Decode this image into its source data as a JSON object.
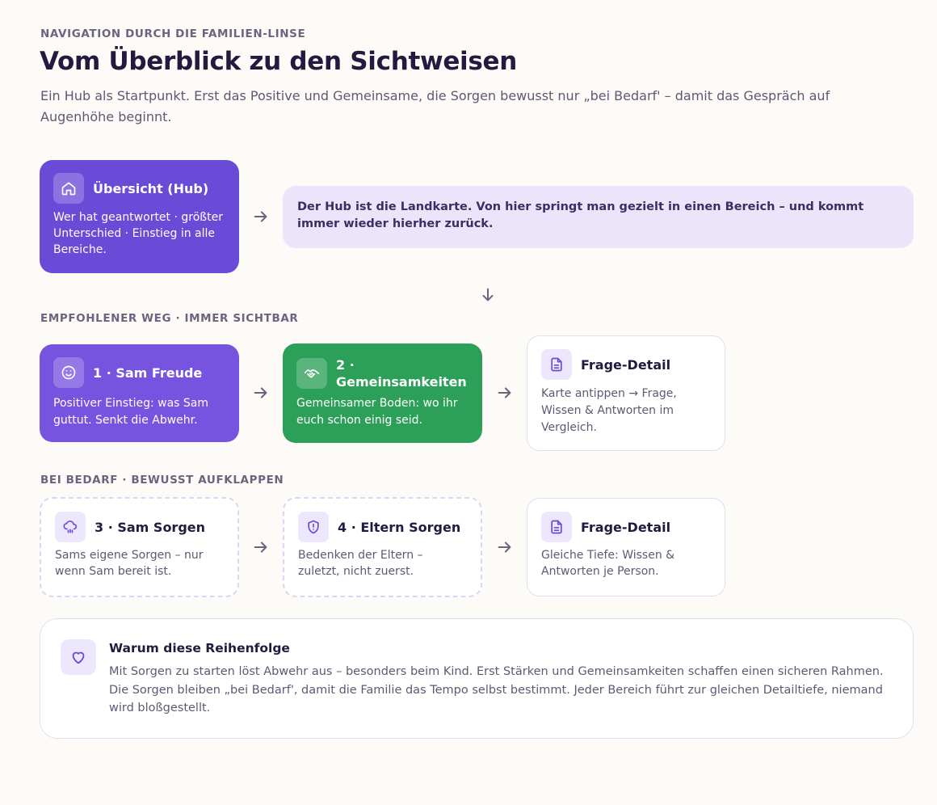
{
  "header": {
    "eyebrow": "NAVIGATION DURCH DIE FAMILIEN-LINSE",
    "title": "Vom Überblick zu den Sichtweisen",
    "subtitle": "Ein Hub als Startpunkt. Erst das Positive und Gemeinsame, die Sorgen bewusst nur „bei Bedarf' – damit das Gespräch auf Augenhöhe beginnt."
  },
  "hub": {
    "icon": "home-icon",
    "title": "Übersicht (Hub)",
    "desc": "Wer hat geantwortet · größter Unterschied · Einstieg in alle Bereiche.",
    "note": "Der Hub ist die Landkarte. Von hier springt man gezielt in einen Bereich – und kommt immer wieder hierher zurück."
  },
  "recommended": {
    "label": "EMPFOHLENER WEG · IMMER SICHTBAR",
    "steps": [
      {
        "icon": "smile-icon",
        "title": "1 · Sam Freude",
        "desc": "Positiver Einstieg: was Sam guttut. Senkt die Abwehr."
      },
      {
        "icon": "handshake-icon",
        "title": "2 · Gemeinsamkeiten",
        "desc": "Gemeinsamer Boden: wo ihr euch schon einig seid."
      },
      {
        "icon": "document-icon",
        "title": "Frage-Detail",
        "desc": "Karte antippen → Frage, Wissen & Antworten im Vergleich."
      }
    ]
  },
  "on_demand": {
    "label": "BEI BEDARF · BEWUSST AUFKLAPPEN",
    "steps": [
      {
        "icon": "rain-cloud-icon",
        "title": "3 · Sam Sorgen",
        "desc": "Sams eigene Sorgen – nur wenn Sam bereit ist."
      },
      {
        "icon": "shield-alert-icon",
        "title": "4 · Eltern Sorgen",
        "desc": "Bedenken der Eltern – zuletzt, nicht zuerst."
      },
      {
        "icon": "document-icon",
        "title": "Frage-Detail",
        "desc": "Gleiche Tiefe: Wissen & Antworten je Person."
      }
    ]
  },
  "why": {
    "icon": "heart-icon",
    "title": "Warum diese Reihenfolge",
    "text": "Mit Sorgen zu starten löst Abwehr aus – besonders beim Kind. Erst Stärken und Gemeinsamkeiten schaffen einen sicheren Rahmen. Die Sorgen bleiben „bei Bedarf', damit die Familie das Tempo selbst bestimmt. Jeder Bereich führt zur gleichen Detailtiefe, niemand wird bloßgestellt."
  },
  "colors": {
    "violet": "#6a4bd8",
    "violet_light": "#7654e0",
    "green": "#2c9f58",
    "note_bg": "#ebe5fc",
    "page_bg": "#fcfbf7"
  }
}
